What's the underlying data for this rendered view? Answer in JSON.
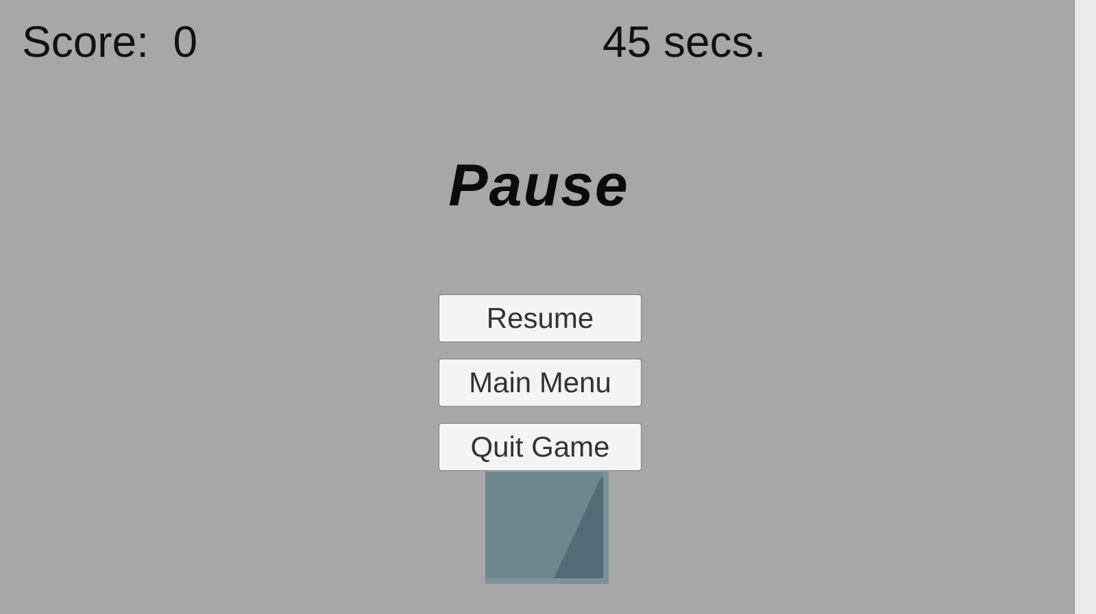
{
  "hud": {
    "score_label": "Score:  0",
    "timer_label": "45 secs."
  },
  "pause_menu": {
    "title": "Pause",
    "buttons": {
      "resume": "Resume",
      "main_menu": "Main Menu",
      "quit_game": "Quit Game"
    }
  },
  "colors": {
    "background": "#a7a7a7",
    "button_fill": "#f4f4f4",
    "button_text": "#333333",
    "paddle": "#6e868d",
    "paddle_shade": "#566b75"
  }
}
